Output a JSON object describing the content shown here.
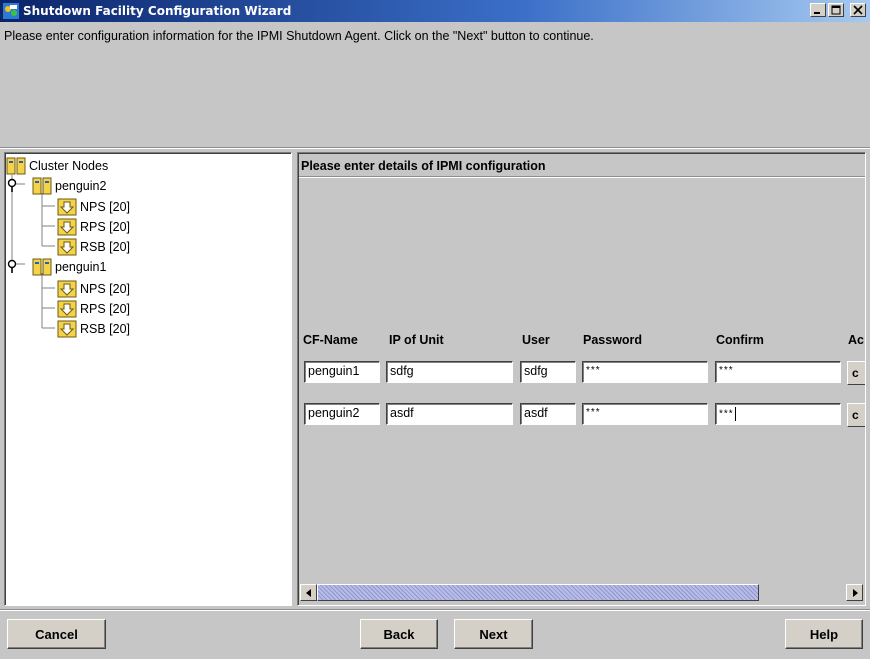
{
  "window": {
    "title": "Shutdown Facility Configuration Wizard",
    "icon": "wizard-app-icon",
    "controls": [
      "minimize-icon",
      "maximize-icon",
      "close-icon"
    ]
  },
  "message": "Please enter configuration information for the IPMI Shutdown Agent. Click on the \"Next\" button to continue.",
  "tree": {
    "root": "Cluster Nodes",
    "nodes": [
      {
        "name": "penguin2",
        "children": [
          "NPS [20]",
          "RPS [20]",
          "RSB [20]"
        ]
      },
      {
        "name": "penguin1",
        "children": [
          "NPS [20]",
          "RPS [20]",
          "RSB [20]"
        ]
      }
    ]
  },
  "panel": {
    "title": "Please enter details of IPMI configuration",
    "columns": [
      "CF-Name",
      "IP of Unit",
      "User",
      "Password",
      "Confirm",
      "Ac"
    ],
    "rows": [
      {
        "cf_name": "penguin1",
        "ip": "sdfg",
        "user": "sdfg",
        "password": "***",
        "confirm": "***",
        "action": "c"
      },
      {
        "cf_name": "penguin2",
        "ip": "asdf",
        "user": "asdf",
        "password": "***",
        "confirm": "***",
        "action": "c"
      }
    ]
  },
  "buttons": {
    "cancel": "Cancel",
    "back": "Back",
    "next": "Next",
    "help": "Help"
  }
}
